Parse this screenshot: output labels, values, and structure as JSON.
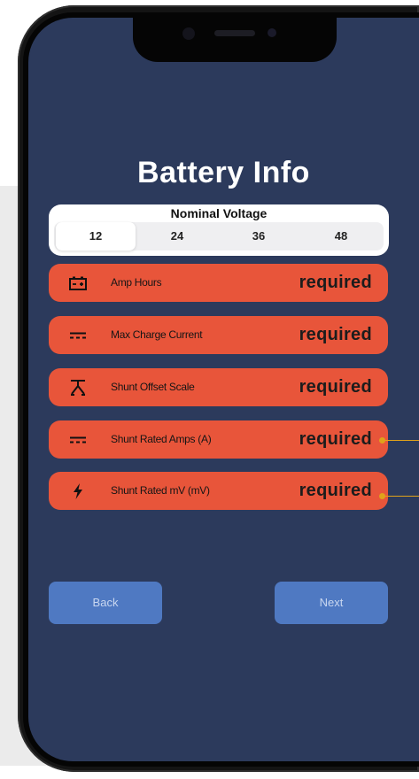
{
  "screen": {
    "title": "Battery Info"
  },
  "nominal_voltage": {
    "title": "Nominal Voltage",
    "options": [
      "12",
      "24",
      "36",
      "48"
    ],
    "selected": "12"
  },
  "fields": [
    {
      "label": "Amp Hours",
      "value": "required",
      "icon": "battery-icon"
    },
    {
      "label": "Max Charge Current",
      "value": "required",
      "icon": "dc-current-icon"
    },
    {
      "label": "Shunt Offset Scale",
      "value": "required",
      "icon": "scale-icon"
    },
    {
      "label": "Shunt Rated Amps (A)",
      "value": "required",
      "icon": "dc-current-icon"
    },
    {
      "label": "Shunt Rated mV (mV)",
      "value": "required",
      "icon": "lightning-bolt-icon"
    }
  ],
  "buttons": {
    "back": "Back",
    "next": "Next"
  },
  "colors": {
    "screen_bg": "#2c3a5c",
    "field_bg": "#e8553a",
    "button_bg": "#4f79c2",
    "callout": "#e0a21a"
  }
}
